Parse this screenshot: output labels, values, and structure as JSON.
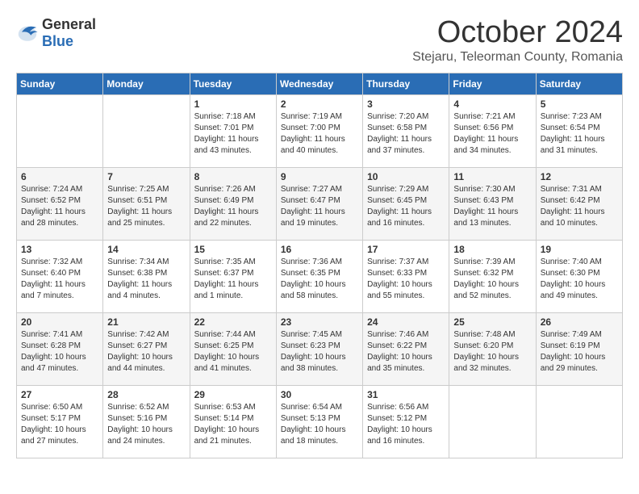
{
  "logo": {
    "general": "General",
    "blue": "Blue"
  },
  "title": "October 2024",
  "location": "Stejaru, Teleorman County, Romania",
  "headers": [
    "Sunday",
    "Monday",
    "Tuesday",
    "Wednesday",
    "Thursday",
    "Friday",
    "Saturday"
  ],
  "weeks": [
    [
      {
        "day": "",
        "content": ""
      },
      {
        "day": "",
        "content": ""
      },
      {
        "day": "1",
        "content": "Sunrise: 7:18 AM\nSunset: 7:01 PM\nDaylight: 11 hours and 43 minutes."
      },
      {
        "day": "2",
        "content": "Sunrise: 7:19 AM\nSunset: 7:00 PM\nDaylight: 11 hours and 40 minutes."
      },
      {
        "day": "3",
        "content": "Sunrise: 7:20 AM\nSunset: 6:58 PM\nDaylight: 11 hours and 37 minutes."
      },
      {
        "day": "4",
        "content": "Sunrise: 7:21 AM\nSunset: 6:56 PM\nDaylight: 11 hours and 34 minutes."
      },
      {
        "day": "5",
        "content": "Sunrise: 7:23 AM\nSunset: 6:54 PM\nDaylight: 11 hours and 31 minutes."
      }
    ],
    [
      {
        "day": "6",
        "content": "Sunrise: 7:24 AM\nSunset: 6:52 PM\nDaylight: 11 hours and 28 minutes."
      },
      {
        "day": "7",
        "content": "Sunrise: 7:25 AM\nSunset: 6:51 PM\nDaylight: 11 hours and 25 minutes."
      },
      {
        "day": "8",
        "content": "Sunrise: 7:26 AM\nSunset: 6:49 PM\nDaylight: 11 hours and 22 minutes."
      },
      {
        "day": "9",
        "content": "Sunrise: 7:27 AM\nSunset: 6:47 PM\nDaylight: 11 hours and 19 minutes."
      },
      {
        "day": "10",
        "content": "Sunrise: 7:29 AM\nSunset: 6:45 PM\nDaylight: 11 hours and 16 minutes."
      },
      {
        "day": "11",
        "content": "Sunrise: 7:30 AM\nSunset: 6:43 PM\nDaylight: 11 hours and 13 minutes."
      },
      {
        "day": "12",
        "content": "Sunrise: 7:31 AM\nSunset: 6:42 PM\nDaylight: 11 hours and 10 minutes."
      }
    ],
    [
      {
        "day": "13",
        "content": "Sunrise: 7:32 AM\nSunset: 6:40 PM\nDaylight: 11 hours and 7 minutes."
      },
      {
        "day": "14",
        "content": "Sunrise: 7:34 AM\nSunset: 6:38 PM\nDaylight: 11 hours and 4 minutes."
      },
      {
        "day": "15",
        "content": "Sunrise: 7:35 AM\nSunset: 6:37 PM\nDaylight: 11 hours and 1 minute."
      },
      {
        "day": "16",
        "content": "Sunrise: 7:36 AM\nSunset: 6:35 PM\nDaylight: 10 hours and 58 minutes."
      },
      {
        "day": "17",
        "content": "Sunrise: 7:37 AM\nSunset: 6:33 PM\nDaylight: 10 hours and 55 minutes."
      },
      {
        "day": "18",
        "content": "Sunrise: 7:39 AM\nSunset: 6:32 PM\nDaylight: 10 hours and 52 minutes."
      },
      {
        "day": "19",
        "content": "Sunrise: 7:40 AM\nSunset: 6:30 PM\nDaylight: 10 hours and 49 minutes."
      }
    ],
    [
      {
        "day": "20",
        "content": "Sunrise: 7:41 AM\nSunset: 6:28 PM\nDaylight: 10 hours and 47 minutes."
      },
      {
        "day": "21",
        "content": "Sunrise: 7:42 AM\nSunset: 6:27 PM\nDaylight: 10 hours and 44 minutes."
      },
      {
        "day": "22",
        "content": "Sunrise: 7:44 AM\nSunset: 6:25 PM\nDaylight: 10 hours and 41 minutes."
      },
      {
        "day": "23",
        "content": "Sunrise: 7:45 AM\nSunset: 6:23 PM\nDaylight: 10 hours and 38 minutes."
      },
      {
        "day": "24",
        "content": "Sunrise: 7:46 AM\nSunset: 6:22 PM\nDaylight: 10 hours and 35 minutes."
      },
      {
        "day": "25",
        "content": "Sunrise: 7:48 AM\nSunset: 6:20 PM\nDaylight: 10 hours and 32 minutes."
      },
      {
        "day": "26",
        "content": "Sunrise: 7:49 AM\nSunset: 6:19 PM\nDaylight: 10 hours and 29 minutes."
      }
    ],
    [
      {
        "day": "27",
        "content": "Sunrise: 6:50 AM\nSunset: 5:17 PM\nDaylight: 10 hours and 27 minutes."
      },
      {
        "day": "28",
        "content": "Sunrise: 6:52 AM\nSunset: 5:16 PM\nDaylight: 10 hours and 24 minutes."
      },
      {
        "day": "29",
        "content": "Sunrise: 6:53 AM\nSunset: 5:14 PM\nDaylight: 10 hours and 21 minutes."
      },
      {
        "day": "30",
        "content": "Sunrise: 6:54 AM\nSunset: 5:13 PM\nDaylight: 10 hours and 18 minutes."
      },
      {
        "day": "31",
        "content": "Sunrise: 6:56 AM\nSunset: 5:12 PM\nDaylight: 10 hours and 16 minutes."
      },
      {
        "day": "",
        "content": ""
      },
      {
        "day": "",
        "content": ""
      }
    ]
  ]
}
